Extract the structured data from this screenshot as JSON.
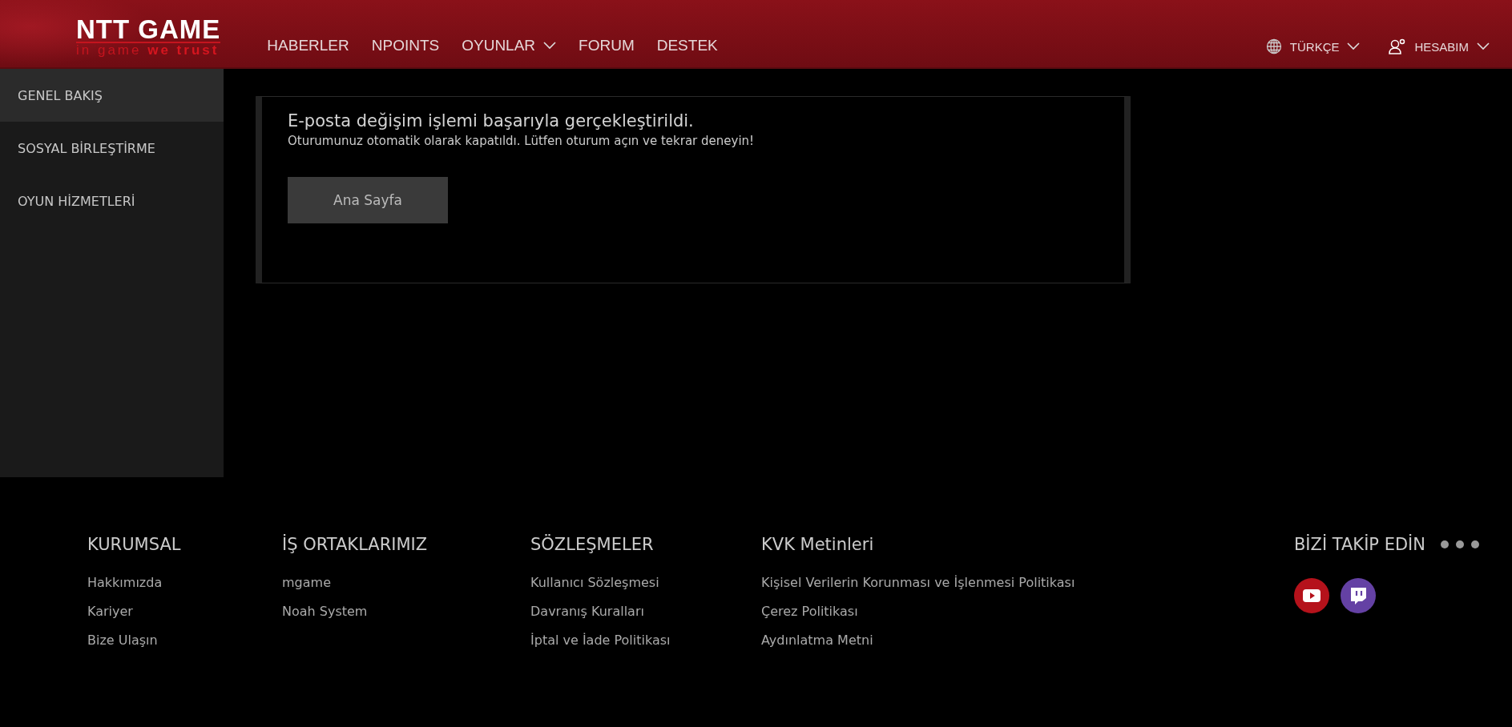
{
  "header": {
    "logo": {
      "title": "NTT GAME",
      "tagline": "in game **we trust**"
    },
    "nav": [
      {
        "label": "HABERLER",
        "has_menu": false
      },
      {
        "label": "NPOINTS",
        "has_menu": false
      },
      {
        "label": "OYUNLAR",
        "has_menu": true
      },
      {
        "label": "FORUM",
        "has_menu": false
      },
      {
        "label": "DESTEK",
        "has_menu": false
      }
    ],
    "language": {
      "label": "TÜRKÇE",
      "has_menu": true
    },
    "account": {
      "label": "HESABIM",
      "has_menu": true
    }
  },
  "sidebar": {
    "items": [
      {
        "label": "GENEL BAKIŞ",
        "selected": true
      },
      {
        "label": "SOSYAL BİRLEŞTİRME",
        "selected": false
      },
      {
        "label": "OYUN HİZMETLERİ",
        "selected": false
      }
    ]
  },
  "notice": {
    "title": "E-posta değişim işlemi başarıyla gerçekleştirildi.",
    "message": "Oturumunuz otomatik olarak kapatıldı. Lütfen oturum açın ve tekrar deneyin!",
    "button": "Ana Sayfa"
  },
  "footer": {
    "columns": [
      {
        "heading": "KURUMSAL",
        "links": [
          "Hakkımızda",
          "Kariyer",
          "Bize Ulaşın"
        ]
      },
      {
        "heading": "İŞ ORTAKLARIMIZ",
        "links": [
          "mgame",
          "Noah System"
        ]
      },
      {
        "heading": "SÖZLEŞMELER",
        "links": [
          "Kullanıcı Sözleşmesi",
          "Davranış Kuralları",
          "İptal ve İade Politikası"
        ]
      },
      {
        "heading": "KVK Metinleri",
        "links": [
          "Kişisel Verilerin Korunması ve İşlenmesi Politikası",
          "Çerez Politikası",
          "Aydınlatma Metni"
        ]
      }
    ],
    "follow": {
      "heading": "BİZİ TAKİP EDİN",
      "socials": [
        {
          "kind": "video",
          "color": "#b5121b"
        },
        {
          "kind": "stream",
          "color": "#6441a4"
        }
      ]
    }
  }
}
